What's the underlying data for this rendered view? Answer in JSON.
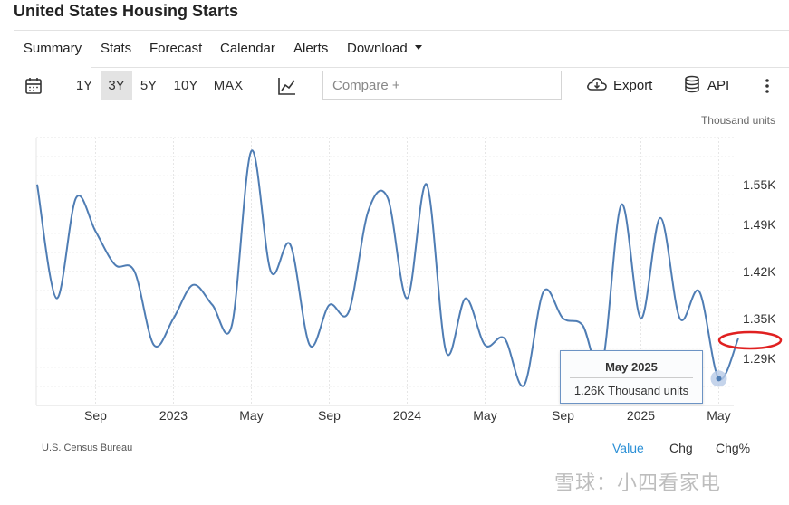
{
  "page_title": "United States Housing Starts",
  "tabs": [
    {
      "label": "Summary"
    },
    {
      "label": "Stats"
    },
    {
      "label": "Forecast"
    },
    {
      "label": "Calendar"
    },
    {
      "label": "Alerts"
    },
    {
      "label": "Download"
    }
  ],
  "toolbar": {
    "ranges": [
      "1Y",
      "3Y",
      "5Y",
      "10Y",
      "MAX"
    ],
    "active_range": "3Y",
    "compare_placeholder": "Compare +",
    "export_label": "Export",
    "api_label": "API"
  },
  "chart_data": {
    "type": "line",
    "unit_label": "Thousand units",
    "y_ticks": [
      "1.55K",
      "1.49K",
      "1.42K",
      "1.35K",
      "1.29K"
    ],
    "y_tick_values": [
      1.55,
      1.49,
      1.42,
      1.35,
      1.29
    ],
    "x_ticks": [
      "Sep",
      "2023",
      "May",
      "Sep",
      "2024",
      "May",
      "Sep",
      "2025",
      "May"
    ],
    "x_tick_months": [
      "2022-09",
      "2023-01",
      "2023-05",
      "2023-09",
      "2024-01",
      "2024-05",
      "2024-09",
      "2025-01",
      "2025-05"
    ],
    "ylim": [
      1.22,
      1.62
    ],
    "grid": true,
    "series": [
      {
        "color": "#4f7db4",
        "x": [
          "2022-06",
          "2022-07",
          "2022-08",
          "2022-09",
          "2022-10",
          "2022-11",
          "2022-12",
          "2023-01",
          "2023-02",
          "2023-03",
          "2023-04",
          "2023-05",
          "2023-06",
          "2023-07",
          "2023-08",
          "2023-09",
          "2023-10",
          "2023-11",
          "2023-12",
          "2024-01",
          "2024-02",
          "2024-03",
          "2024-04",
          "2024-05",
          "2024-06",
          "2024-07",
          "2024-08",
          "2024-09",
          "2024-10",
          "2024-11",
          "2024-12",
          "2025-01",
          "2025-02",
          "2025-03",
          "2025-04",
          "2025-05",
          "2025-06"
        ],
        "values": [
          1.55,
          1.38,
          1.53,
          1.48,
          1.43,
          1.42,
          1.31,
          1.35,
          1.4,
          1.37,
          1.34,
          1.6,
          1.42,
          1.46,
          1.31,
          1.37,
          1.36,
          1.51,
          1.53,
          1.38,
          1.55,
          1.3,
          1.38,
          1.31,
          1.32,
          1.25,
          1.39,
          1.35,
          1.34,
          1.28,
          1.52,
          1.35,
          1.5,
          1.35,
          1.39,
          1.26,
          1.32
        ]
      }
    ],
    "highlight": {
      "x": "2025-05",
      "value": 1.26
    }
  },
  "tooltip": {
    "title": "May 2025",
    "value": "1.26K Thousand units"
  },
  "source": "U.S. Census Bureau",
  "view_tabs": [
    "Value",
    "Chg",
    "Chg%"
  ],
  "watermark": "雪球：小四看家电",
  "colors": {
    "line": "#4f7db4",
    "annotation": "#e02020",
    "active_view": "#2a8fd6"
  }
}
